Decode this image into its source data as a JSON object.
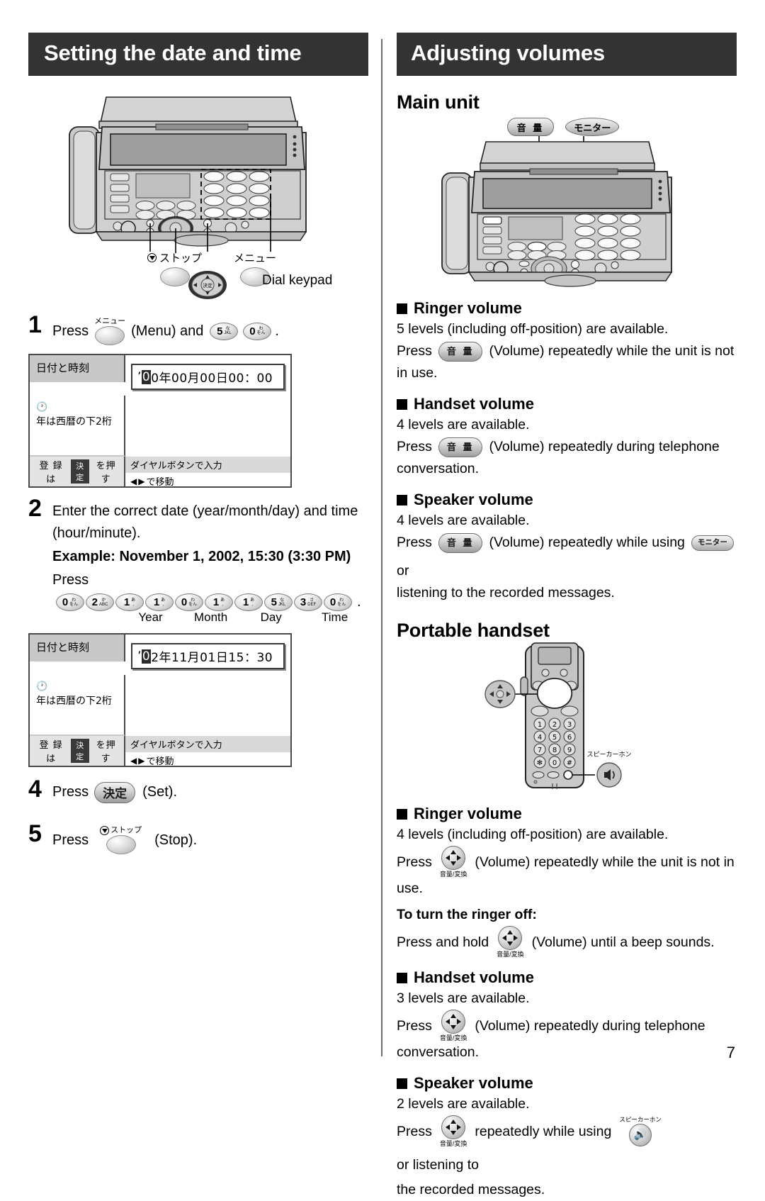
{
  "page": {
    "number": "7"
  },
  "left": {
    "banner": "Setting the date and time",
    "illustration": {
      "callout_stop_jp": "ストップ",
      "callout_menu_jp": "メニュー",
      "callout_dial_keypad": "Dial keypad",
      "navigator_center_jp": "決定"
    },
    "steps": [
      {
        "num": "1",
        "press_label": "Press",
        "menu_jp": "メニュー",
        "mid_text": "(Menu) and",
        "keys": [
          {
            "digit": "5",
            "kana1": "な",
            "kana2": "JKL"
          },
          {
            "digit": "0",
            "kana1": "わ",
            "kana2": "をん"
          }
        ],
        "trailing": "."
      },
      {
        "num": "2",
        "line1": "Enter the correct date (year/month/day) and time",
        "line2": "(hour/minute).",
        "example": "Example: November 1, 2002, 15:30 (3:30 PM)",
        "press_label": "Press",
        "keys": [
          {
            "digit": "0",
            "kana1": "わ",
            "kana2": "をん"
          },
          {
            "digit": "2",
            "kana1": "か",
            "kana2": "ABC"
          },
          {
            "digit": "1",
            "kana1": "あ",
            "kana2": ","
          },
          {
            "digit": "1",
            "kana1": "あ",
            "kana2": ","
          },
          {
            "digit": "0",
            "kana1": "わ",
            "kana2": "をん"
          },
          {
            "digit": "1",
            "kana1": "あ",
            "kana2": ","
          },
          {
            "digit": "1",
            "kana1": "あ",
            "kana2": ","
          },
          {
            "digit": "5",
            "kana1": "な",
            "kana2": "JKL"
          },
          {
            "digit": "3",
            "kana1": "さ",
            "kana2": "DEF"
          },
          {
            "digit": "0",
            "kana1": "わ",
            "kana2": "をん"
          }
        ],
        "trailing": ".",
        "brace_labels": [
          "Year",
          "Month",
          "Day",
          "Time"
        ]
      },
      {
        "num": "4",
        "press_label": "Press",
        "set_jp": "決定",
        "after": "(Set)."
      },
      {
        "num": "5",
        "press_label": "Press",
        "stop_jp": "ストップ",
        "after": "(Stop)."
      }
    ],
    "lcd1": {
      "title_jp": "日付と時刻",
      "field_cursor": "0",
      "field_rest": "0年00月00日00：00",
      "field_prefix": "’",
      "note_jp": "年は西暦の下2桁",
      "footer_left_a": "登 録  は",
      "footer_left_key": "決定",
      "footer_left_b": "を押す",
      "footer_right_1": "ダイヤルボタンで入力",
      "footer_right_2": "で移動"
    },
    "lcd2": {
      "title_jp": "日付と時刻",
      "field_cursor": "0",
      "field_rest": "2年11月01日15：30",
      "field_prefix": "’",
      "note_jp": "年は西暦の下2桁",
      "footer_left_a": "登 録  は",
      "footer_left_key": "決定",
      "footer_left_b": "を押す",
      "footer_right_1": "ダイヤルボタンで入力",
      "footer_right_2": "で移動"
    }
  },
  "right": {
    "banner": "Adjusting volumes",
    "main_unit_heading": "Main unit",
    "main_unit_callouts": {
      "volume_jp": "音 量",
      "monitor_jp": "モニター"
    },
    "portable_heading": "Portable handset",
    "portable_callouts": {
      "speakerphone_jp": "スピーカーホン",
      "keypad": [
        "1",
        "2",
        "3",
        "4",
        "5",
        "6",
        "7",
        "8",
        "9",
        "✻",
        "0",
        "#"
      ]
    },
    "main_sections": [
      {
        "title": "Ringer volume",
        "levels": "5 levels (including off-position) are available.",
        "press": "Press",
        "button_jp": "音 量",
        "text_after": "(Volume) repeatedly while the unit is not",
        "text_wrap": "in use."
      },
      {
        "title": "Handset volume",
        "levels": "4 levels are available.",
        "press": "Press",
        "button_jp": "音 量",
        "text_after": "(Volume) repeatedly during telephone",
        "text_wrap": "conversation."
      },
      {
        "title": "Speaker volume",
        "levels": "4 levels are available.",
        "press": "Press",
        "button_jp": "音 量",
        "text_after": "(Volume) repeatedly while using",
        "monitor_jp": "モニター",
        "text_or": "or",
        "text_wrap": "listening to the recorded messages."
      }
    ],
    "portable_sections": [
      {
        "title": "Ringer volume",
        "levels": "4 levels (including off-position) are available.",
        "press": "Press",
        "nav_caption": "音量/変換",
        "text_after": "(Volume) repeatedly while the unit is not in",
        "text_wrap": "use.",
        "subhead": "To turn the ringer off:",
        "sub_press": "Press and hold",
        "sub_nav_caption": "音量/変換",
        "sub_after": "(Volume) until a beep sounds."
      },
      {
        "title": "Handset volume",
        "levels": "3 levels are available.",
        "press": "Press",
        "nav_caption": "音量/変換",
        "text_after": "(Volume) repeatedly during telephone",
        "text_wrap": "conversation."
      },
      {
        "title": "Speaker volume",
        "levels": "2 levels are available.",
        "press": "Press",
        "nav_caption": "音量/変換",
        "text_after": "repeatedly while using",
        "speaker_caption": "スピーカーホン",
        "text_or": "or listening to",
        "text_wrap": "the recorded messages."
      }
    ]
  }
}
